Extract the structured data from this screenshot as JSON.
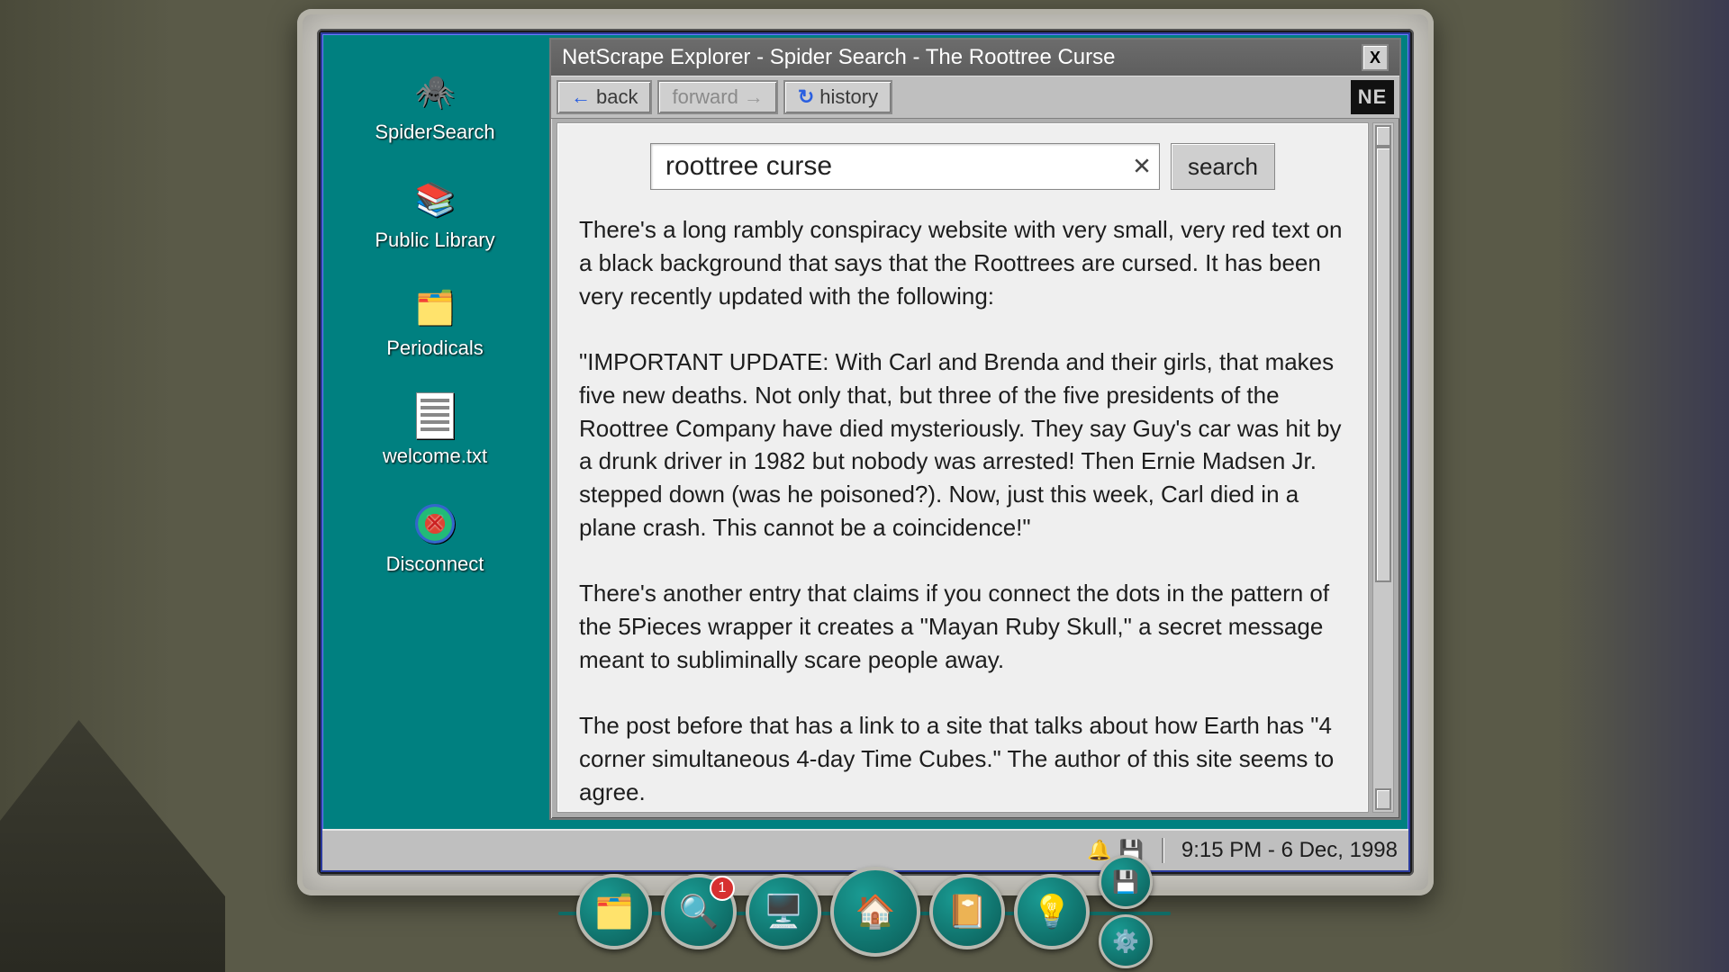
{
  "window": {
    "title": "NetScrape Explorer - Spider Search - The Roottree Curse",
    "close_glyph": "X",
    "brand": "NE"
  },
  "toolbar": {
    "back": "back",
    "forward": "forward",
    "history": "history",
    "back_arrow": "←",
    "fwd_arrow": "→",
    "history_glyph": "↻"
  },
  "search": {
    "query": "roottree curse",
    "clear_glyph": "✕",
    "button": "search"
  },
  "article": {
    "p1": "There's a long rambly conspiracy website with very small, very red text on a black background that says that the Roottrees are cursed. It has been very recently updated with the following:",
    "p2": "\"IMPORTANT UPDATE: With Carl and Brenda and their girls, that makes five new deaths. Not only that, but three of the five presidents of the Roottree Company have died mysteriously. They say Guy's car was hit by a drunk driver in 1982 but nobody was arrested! Then Ernie Madsen Jr. stepped down (was he poisoned?). Now, just this week, Carl died in a plane crash. This cannot be a coincidence!\"",
    "p3": "There's another entry that claims if you connect the dots in the pattern of the 5Pieces wrapper it creates a \"Mayan Ruby Skull,\" a secret message meant to subliminally scare people away.",
    "p4": "The post before that has a link to a site that talks about how Earth has \"4 corner simultaneous 4-day Time Cubes.\" The author of this site seems to agree."
  },
  "desktop": {
    "items": [
      {
        "label": "SpiderSearch",
        "glyph": "🕷️"
      },
      {
        "label": "Public Library",
        "glyph": "📚"
      },
      {
        "label": "Periodicals",
        "glyph": "🗂️"
      },
      {
        "label": "welcome.txt",
        "glyph": "txt"
      },
      {
        "label": "Disconnect",
        "glyph": "disc"
      }
    ]
  },
  "taskbar": {
    "bell": "🔔",
    "disk": "💾",
    "clock": "9:15 PM - 6 Dec, 1998"
  },
  "dock": {
    "badge": "1",
    "items": [
      {
        "name": "evidence",
        "glyph": "🗂️"
      },
      {
        "name": "investigate",
        "glyph": "🔍"
      },
      {
        "name": "computer",
        "glyph": "🖥️"
      },
      {
        "name": "home",
        "glyph": "🏠"
      },
      {
        "name": "journal",
        "glyph": "📔"
      },
      {
        "name": "hint",
        "glyph": "💡"
      }
    ],
    "extras": [
      {
        "name": "save",
        "glyph": "💾"
      },
      {
        "name": "settings",
        "glyph": "⚙️"
      }
    ]
  }
}
